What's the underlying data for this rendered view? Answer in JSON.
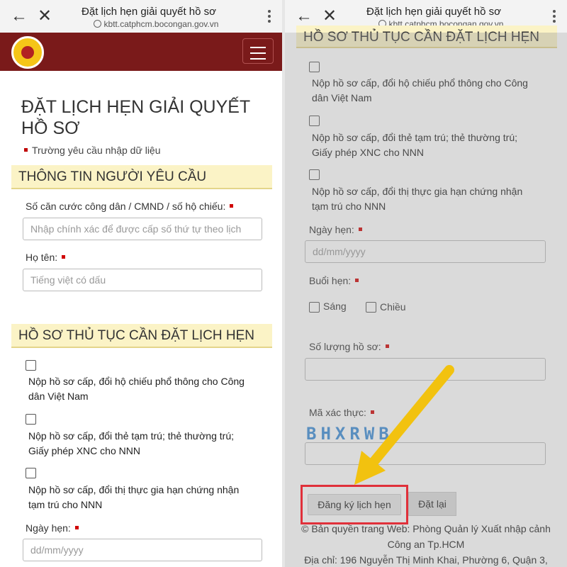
{
  "browser": {
    "title": "Đặt lịch hẹn giải quyết hồ sơ",
    "url": "kbtt.catphcm.bocongan.gov.vn",
    "back_glyph": "←",
    "close_glyph": "✕"
  },
  "left": {
    "page_title": "ĐẶT LỊCH HẸN GIẢI QUYẾT HỒ SƠ",
    "required_note": "Trường yêu cầu nhập dữ liệu",
    "section_requester": "THÔNG TIN NGƯỜI YÊU CẦU",
    "id_label": "Số căn cước công dân / CMND / số hộ chiếu:",
    "id_placeholder": "Nhập chính xác để được cấp số thứ tự theo lịch",
    "name_label": "Họ tên:",
    "name_placeholder": "Tiếng việt có dấu",
    "section_procedures": "HỒ SƠ THỦ TỤC CẦN ĐẶT LỊCH HẸN",
    "procedures": [
      {
        "line1": "Nộp hồ sơ cấp, đổi hộ chiếu phổ thông cho Công",
        "line2": "dân Việt Nam"
      },
      {
        "line1": "Nộp hồ sơ cấp, đổi thẻ tạm trú; thẻ thường trú;",
        "line2": "Giấy phép XNC cho NNN"
      },
      {
        "line1": "Nộp hồ sơ cấp, đổi thị thực gia hạn chứng nhận",
        "line2": "tạm trú cho NNN"
      }
    ],
    "date_label": "Ngày hẹn:",
    "date_placeholder": "dd/mm/yyyy"
  },
  "right": {
    "section_procedures": "HỒ SƠ THỦ TỤC CẦN ĐẶT LỊCH HẸN",
    "procedures": [
      {
        "line1": "Nộp hồ sơ cấp, đổi hộ chiếu phổ thông cho Công",
        "line2": "dân Việt Nam"
      },
      {
        "line1": "Nộp hồ sơ cấp, đổi thẻ tạm trú; thẻ thường trú;",
        "line2": "Giấy phép XNC cho NNN"
      },
      {
        "line1": "Nộp hồ sơ cấp, đổi thị thực gia hạn chứng nhận",
        "line2": "tạm trú cho NNN"
      }
    ],
    "date_label": "Ngày hẹn:",
    "date_placeholder": "dd/mm/yyyy",
    "session_label": "Buổi hẹn:",
    "session_morning": "Sáng",
    "session_afternoon": "Chiều",
    "count_label": "Số lượng hồ sơ:",
    "captcha_label": "Mã xác thực:",
    "captcha_text": "BHXRWB",
    "register_button": "Đăng ký lịch hẹn",
    "reset_button": "Đặt lại",
    "footer_line1": "© Bản quyền trang Web: Phòng Quản lý Xuất nhập cảnh",
    "footer_line2": "Công an Tp.HCM",
    "footer_line3": "Địa chỉ: 196 Nguyễn Thị Minh Khai, Phường 6, Quận 3,"
  },
  "colors": {
    "header_bg": "#7a1a1a",
    "section_bg": "#fbf3c6",
    "required_red": "#d00000",
    "highlight_red": "#e0303a",
    "arrow_yellow": "#f2c20f",
    "captcha_blue": "#3a8ad6"
  },
  "icons": [
    "back-arrow-icon",
    "close-icon",
    "globe-icon",
    "kebab-menu-icon",
    "hamburger-menu-icon",
    "logo-emblem"
  ]
}
